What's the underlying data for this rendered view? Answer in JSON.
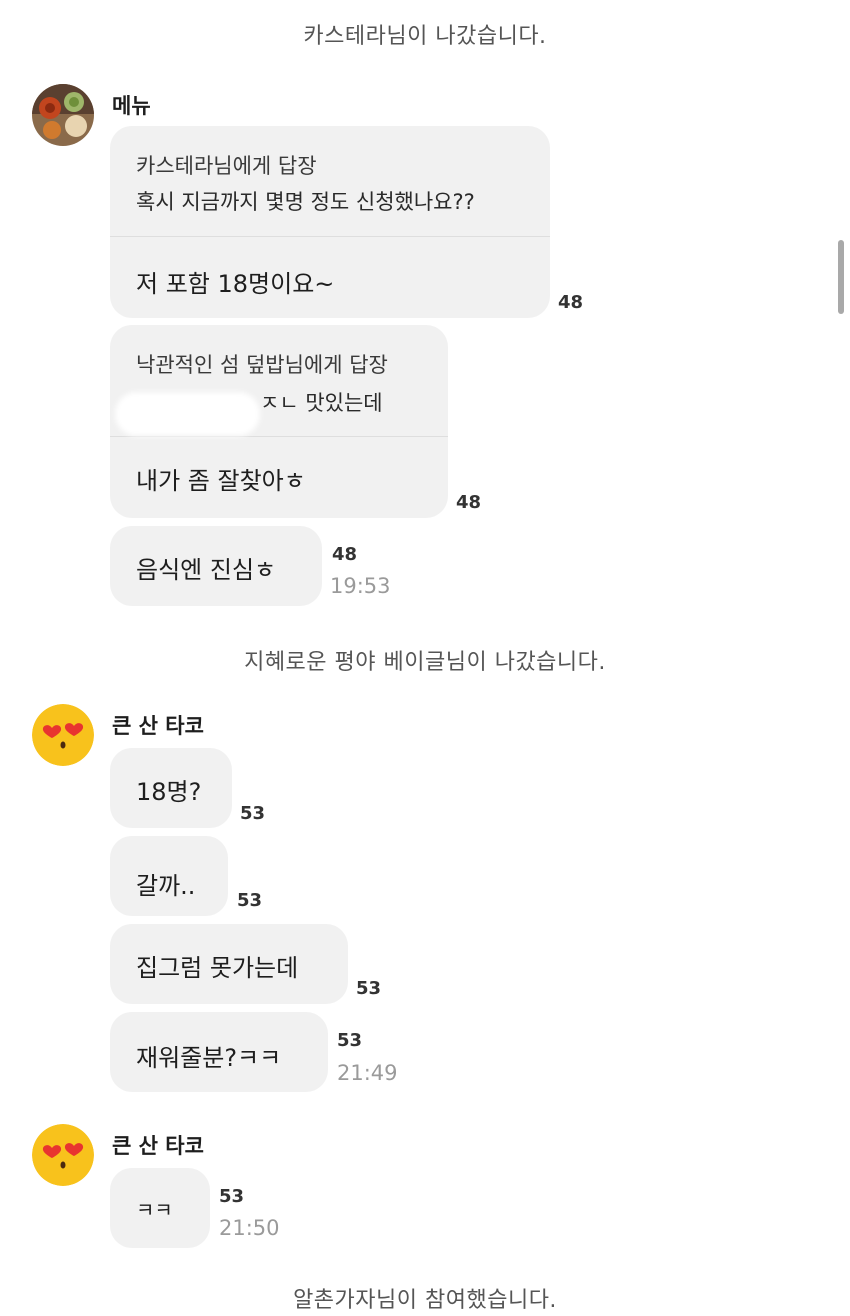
{
  "system_messages": {
    "top": "카스테라님이 나갔습니다.",
    "middle": "지혜로운 평야 베이글님이 나갔습니다.",
    "bottom": "알촌가자님이 참여했습니다."
  },
  "group1": {
    "sender": "메뉴",
    "avatar_icon": "food-photo-avatar",
    "msg1": {
      "reply_to": "카스테라님에게 답장",
      "quoted": "혹시 지금까지 몇명 정도 신청했나요??",
      "text": "저 포함 18명이요~",
      "count": "48"
    },
    "msg2": {
      "reply_to": "낙관적인 섬 덮밥님에게 답장",
      "quoted": "ㅈㄴ 맛있는데",
      "text": "내가 좀 잘찾아ㅎ",
      "count": "48"
    },
    "msg3": {
      "text": "음식엔 진심ㅎ",
      "count": "48",
      "time": "19:53"
    }
  },
  "group2": {
    "sender": "큰 산 타코",
    "avatar_icon": "heart-eyes-emoji-avatar",
    "messages": [
      {
        "text": "18명?",
        "count": "53"
      },
      {
        "text": "갈까..",
        "count": "53"
      },
      {
        "text": "집그럼 못가는데",
        "count": "53"
      },
      {
        "text": "재워줄분?ㅋㅋ",
        "count": "53",
        "time": "21:49"
      }
    ]
  },
  "group3": {
    "sender": "큰 산 타코",
    "avatar_icon": "heart-eyes-emoji-avatar",
    "messages": [
      {
        "text": "ㅋㅋ",
        "count": "53",
        "time": "21:50"
      }
    ]
  },
  "colors": {
    "bubble": "#f1f1f1",
    "background": "#ffffff",
    "timestamp": "#9a9a9a",
    "emoji_yellow": "#f8c21c",
    "heart_red": "#e8342f"
  }
}
